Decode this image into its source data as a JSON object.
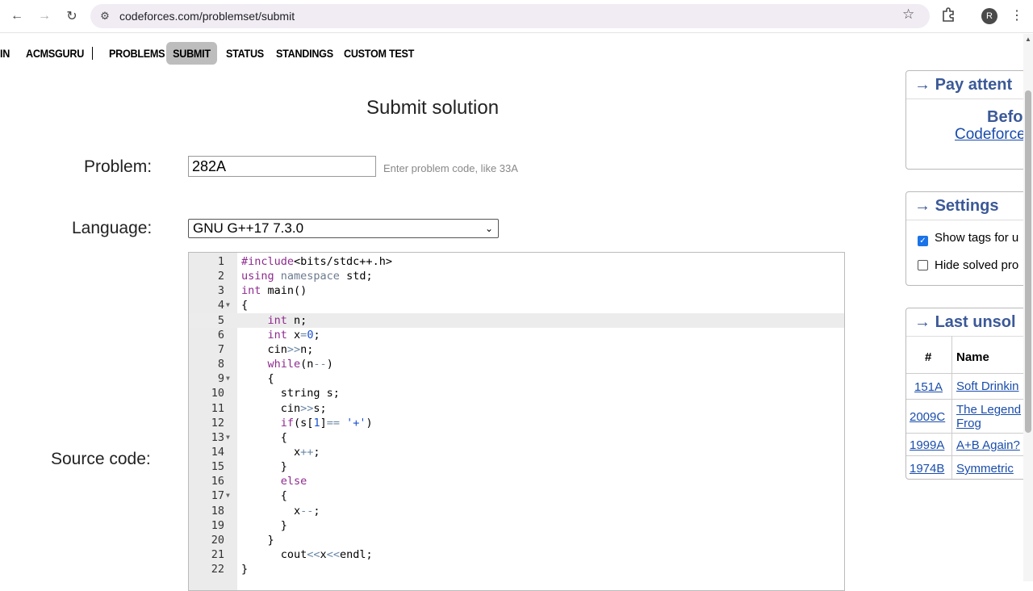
{
  "browser": {
    "url": "codeforces.com/problemset/submit",
    "profile_initial": "R"
  },
  "nav": {
    "items": [
      "IN",
      "ACMSGURU",
      "PROBLEMS",
      "SUBMIT",
      "STATUS",
      "STANDINGS",
      "CUSTOM TEST"
    ],
    "active": "SUBMIT"
  },
  "form": {
    "title": "Submit solution",
    "problem_label": "Problem:",
    "problem_value": "282A",
    "problem_hint": "Enter problem code, like 33A",
    "language_label": "Language:",
    "language_value": "GNU G++17 7.3.0",
    "source_label": "Source code:"
  },
  "editor": {
    "active_line": 5,
    "lines": [
      "#include<bits/stdc++.h>",
      "using namespace std;",
      "int main()",
      "{",
      "    int n;",
      "    int x=0;",
      "    cin>>n;",
      "    while(n--)",
      "    {",
      "      string s;",
      "      cin>>s;",
      "      if(s[1]== '+')",
      "      {",
      "        x++;",
      "      }",
      "      else",
      "      {",
      "        x--;",
      "      }",
      "    }",
      "      cout<<x<<endl;",
      "}"
    ]
  },
  "sidebar": {
    "pay_attention": {
      "title": "Pay attent",
      "line1": "Befo",
      "link": "Codeforce"
    },
    "settings": {
      "title": "Settings",
      "show_tags": "Show tags for u",
      "hide_solved": "Hide solved pro",
      "show_tags_checked": true,
      "hide_solved_checked": false
    },
    "last_unsolved": {
      "title": "Last unsol",
      "col_id": "#",
      "col_name": "Name",
      "rows": [
        {
          "id": "151A",
          "name": "Soft Drinkin"
        },
        {
          "id": "2009C",
          "name": "The Legend",
          "name2": "Frog"
        },
        {
          "id": "1999A",
          "name": "A+B Again?"
        },
        {
          "id": "1974B",
          "name": "Symmetric "
        }
      ]
    }
  }
}
